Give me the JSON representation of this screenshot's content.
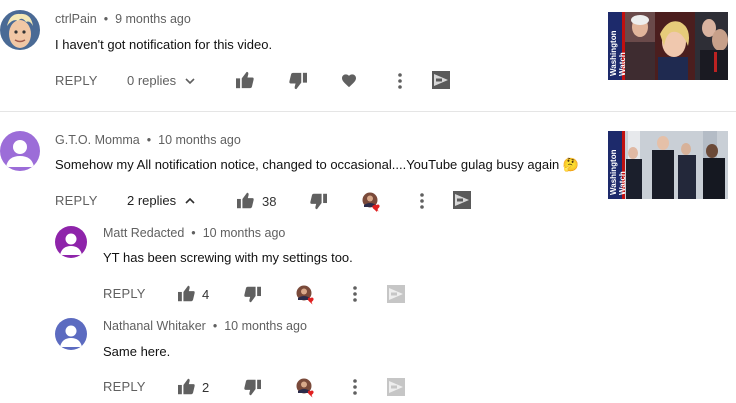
{
  "comments": [
    {
      "author": "ctrlPain",
      "time": "9 months ago",
      "text": "I haven't got notification for this video.",
      "reply_label": "REPLY",
      "replies_label": "0 replies",
      "like_count": "",
      "thumbnail_caption": "Washington Watch"
    },
    {
      "author": "G.T.O. Momma",
      "time": "10 months ago",
      "text": "Somehow my All notification notice, changed to occasional....YouTube gulag busy again 🤔",
      "reply_label": "REPLY",
      "replies_label": "2 replies",
      "like_count": "38",
      "thumbnail_caption": "Washington Watch",
      "replies": [
        {
          "author": "Matt Redacted",
          "time": "10 months ago",
          "text": "YT has been screwing with my settings too.",
          "reply_label": "REPLY",
          "like_count": "4"
        },
        {
          "author": "Nathanal Whitaker",
          "time": "10 months ago",
          "text": "Same here.",
          "reply_label": "REPLY",
          "like_count": "2"
        }
      ]
    }
  ],
  "separator": "•"
}
